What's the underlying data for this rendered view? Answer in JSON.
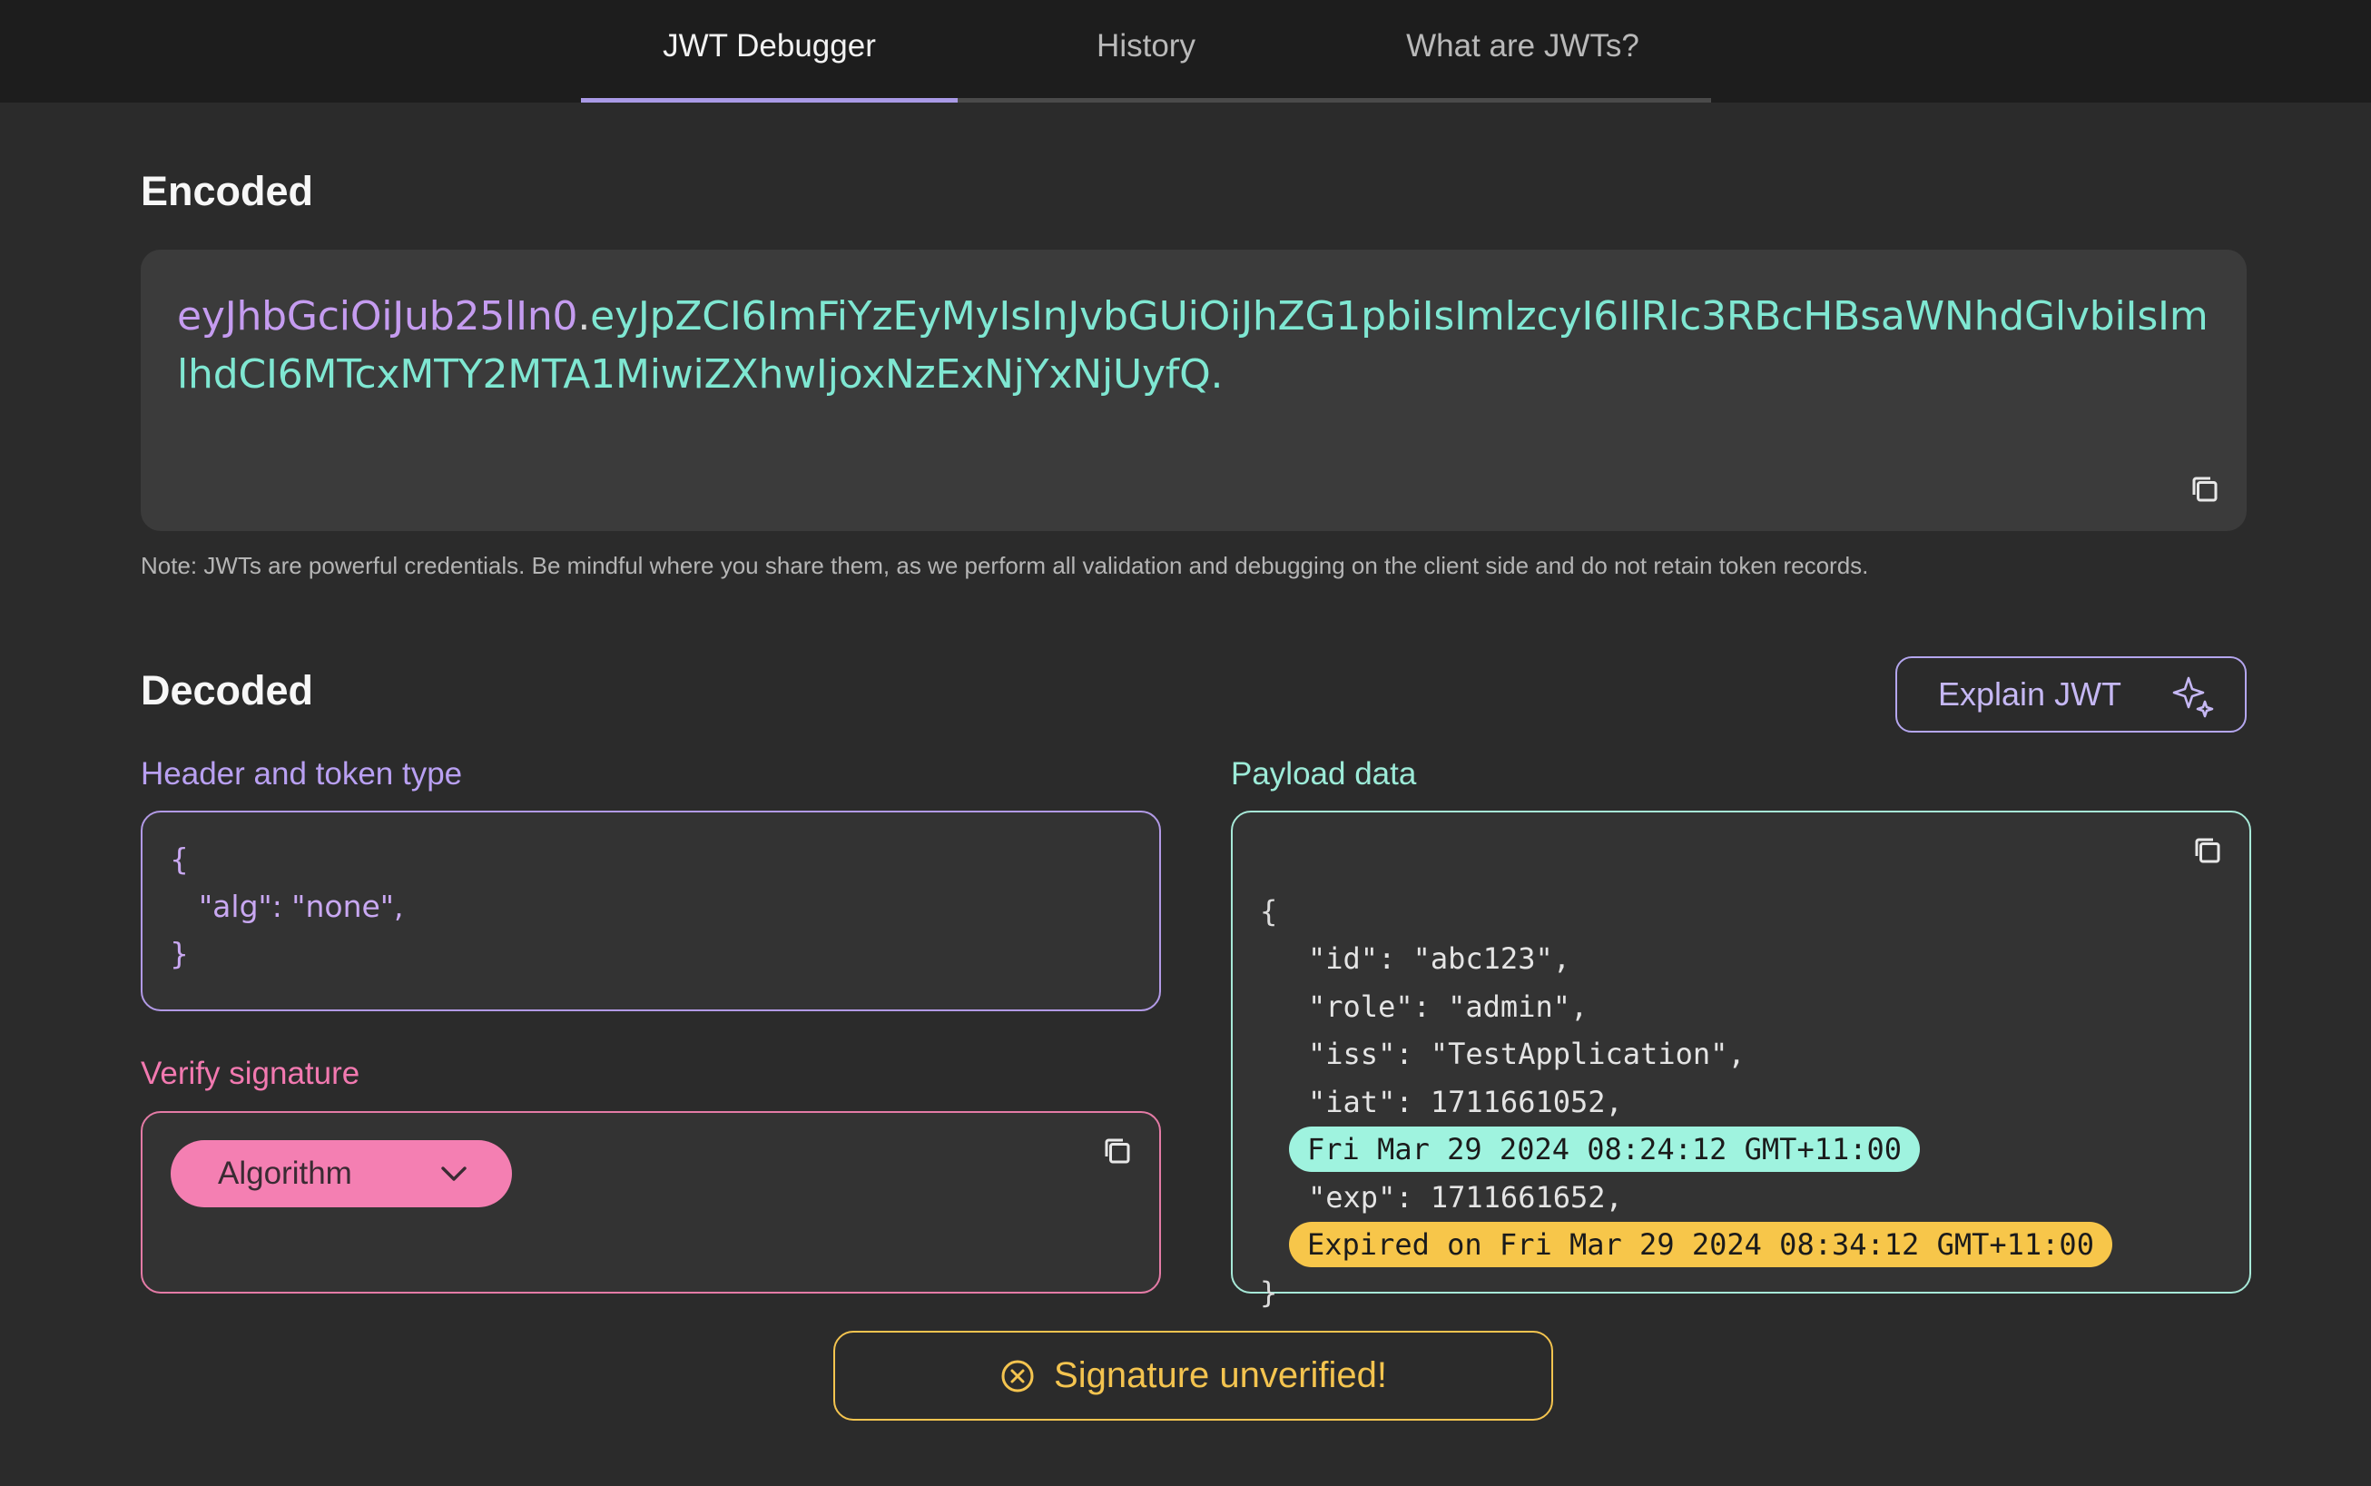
{
  "nav": {
    "tabs": [
      {
        "label": "JWT Debugger",
        "active": true
      },
      {
        "label": "History",
        "active": false
      },
      {
        "label": "What are JWTs?",
        "active": false
      }
    ]
  },
  "encoded": {
    "title": "Encoded",
    "token_header": "eyJhbGciOiJub25lIn0",
    "token_dot1": ".",
    "token_payload": "eyJpZCI6ImFiYzEyMyIsInJvbGUiOiJhZG1pbiIsImlzcyI6IlRlc3RBcHBsaWNhdGlvbiIsImlhdCI6MTcxMTY2MTA1MiwiZXhwIjoxNzExNjYxNjUyfQ",
    "token_dot2": ".",
    "note": "Note: JWTs are powerful credentials. Be mindful where you share them, as we perform all validation and debugging on the client side and do not retain token records."
  },
  "decoded": {
    "title": "Decoded",
    "explain_label": "Explain JWT",
    "header": {
      "label": "Header and token type",
      "open": "{",
      "line": "\"alg\": \"none\",",
      "close": "}"
    },
    "verify": {
      "label": "Verify signature",
      "algorithm_label": "Algorithm"
    },
    "payload": {
      "label": "Payload data",
      "open": "{",
      "id": "\"id\": \"abc123\",",
      "role": "\"role\": \"admin\",",
      "iss": "\"iss\": \"TestApplication\",",
      "iat": "\"iat\": 1711661052,",
      "iat_human": "Fri Mar 29 2024 08:24:12 GMT+11:00",
      "exp": "\"exp\": 1711661652,",
      "exp_human": "Expired on Fri Mar 29 2024 08:34:12 GMT+11:00",
      "close": "}"
    },
    "status": "Signature unverified!"
  },
  "icons": {
    "copy": "copy-icon",
    "sparkle": "sparkle-icon",
    "chevron": "chevron-down-icon",
    "error": "x-circle-icon"
  },
  "colors": {
    "accent_purple": "#a99ae6",
    "token_header": "#c59cf0",
    "token_payload": "#7fe7d2",
    "verify_pink": "#f47fb2",
    "status_amber": "#f4c44f"
  }
}
